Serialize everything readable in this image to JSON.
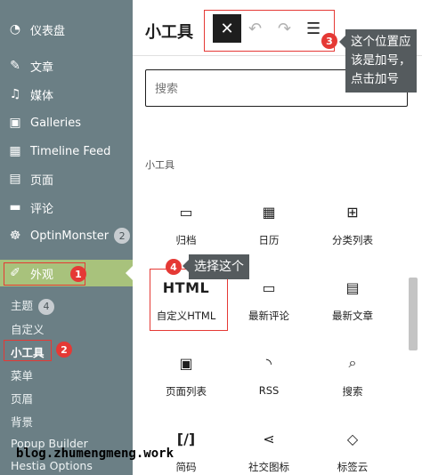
{
  "sidebar": {
    "items": [
      {
        "label": "仪表盘",
        "icon": "dashboard-icon"
      },
      {
        "label": "文章",
        "icon": "pin-icon"
      },
      {
        "label": "媒体",
        "icon": "media-icon"
      },
      {
        "label": "Galleries",
        "icon": "gallery-icon"
      },
      {
        "label": "Timeline Feed",
        "icon": "calendar-icon"
      },
      {
        "label": "页面",
        "icon": "page-icon"
      },
      {
        "label": "评论",
        "icon": "comment-icon"
      },
      {
        "label": "OptinMonster",
        "icon": "monster-icon",
        "badge": "2"
      },
      {
        "label": "外观",
        "icon": "brush-icon",
        "active": true
      }
    ],
    "submenu": [
      {
        "label": "主题",
        "badge": "4"
      },
      {
        "label": "自定义"
      },
      {
        "label": "小工具",
        "current": true
      },
      {
        "label": "菜单"
      },
      {
        "label": "页眉"
      },
      {
        "label": "背景"
      },
      {
        "label": "Popup Builder"
      },
      {
        "label": "Hestia Options"
      }
    ]
  },
  "panel": {
    "title": "小工具",
    "close_label": "✕",
    "search_placeholder": "搜索",
    "section_label": "小工具",
    "blocks": [
      {
        "label": "归档",
        "icon": "folder-icon"
      },
      {
        "label": "日历",
        "icon": "calendar-icon"
      },
      {
        "label": "分类列表",
        "icon": "grid-icon"
      },
      {
        "label": "自定义HTML",
        "icon": "html-icon",
        "icon_text": "HTML"
      },
      {
        "label": "最新评论",
        "icon": "comment-icon"
      },
      {
        "label": "最新文章",
        "icon": "list-icon"
      },
      {
        "label": "页面列表",
        "icon": "pages-icon"
      },
      {
        "label": "RSS",
        "icon": "rss-icon"
      },
      {
        "label": "搜索",
        "icon": "search-icon"
      },
      {
        "label": "简码",
        "icon": "shortcode-icon",
        "icon_text": "[/]"
      },
      {
        "label": "社交图标",
        "icon": "share-icon"
      },
      {
        "label": "标签云",
        "icon": "tag-icon"
      }
    ]
  },
  "annotations": {
    "n1": "1",
    "n2": "2",
    "n3": "3",
    "n4": "4",
    "tip3": "这个位置应该是加号，点击加号",
    "tip4": "选择这个"
  },
  "watermark": "blog.zhumengmeng.work",
  "colors": {
    "sidebar_bg": "#6b7f85",
    "active_bg": "#a8c27c",
    "annotation_red": "#e53935"
  }
}
